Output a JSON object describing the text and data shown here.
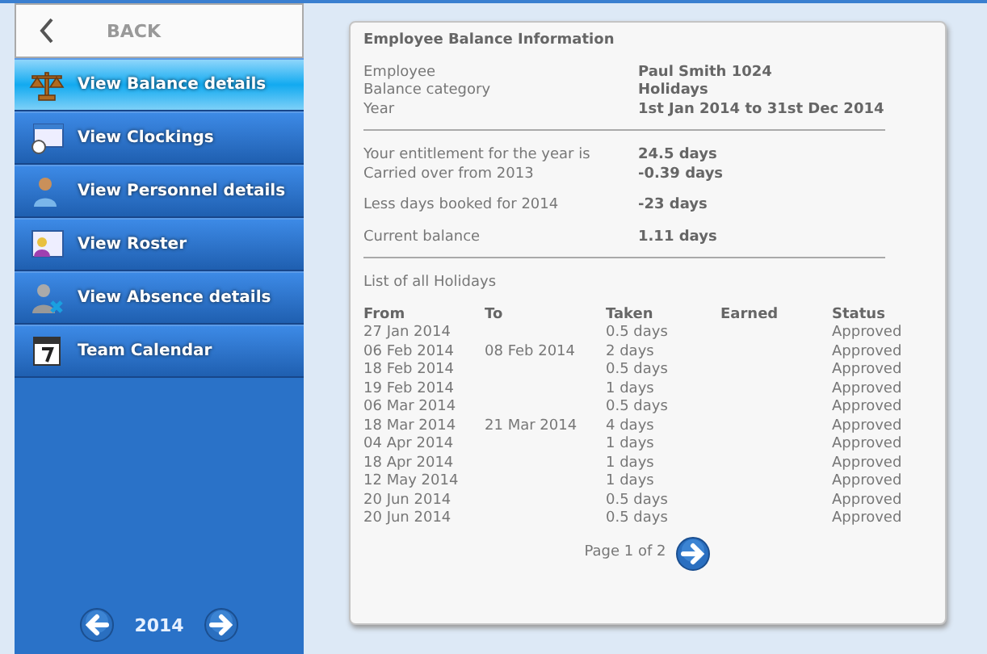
{
  "sidebar": {
    "back": {
      "label": "BACK"
    },
    "items": [
      {
        "label": "View Balance details",
        "selected": true
      },
      {
        "label": "View Clockings",
        "selected": false
      },
      {
        "label": "View Personnel details",
        "selected": false
      },
      {
        "label": "View Roster",
        "selected": false
      },
      {
        "label": "View Absence details",
        "selected": false
      },
      {
        "label": "Team Calendar",
        "selected": false
      }
    ],
    "year": "2014"
  },
  "card": {
    "title": "Employee Balance Information",
    "info": [
      {
        "label": "Employee",
        "value": "Paul Smith 1024"
      },
      {
        "label": "Balance category",
        "value": "Holidays"
      },
      {
        "label": "Year",
        "value": "1st Jan 2014 to 31st Dec 2014"
      }
    ],
    "balance": [
      {
        "label": "Your entitlement for the year is",
        "value": "24.5 days"
      },
      {
        "label": "Carried over from 2013",
        "value": "-0.39 days"
      },
      {
        "label": "Less days booked for 2014",
        "value": "-23 days"
      },
      {
        "label": "Current balance",
        "value": "1.11 days"
      }
    ],
    "list_title": "List of all Holidays",
    "table": {
      "columns": [
        "From",
        "To",
        "Taken",
        "Earned",
        "Status"
      ],
      "rows": [
        {
          "from": "27 Jan 2014",
          "taken": "0.5 days",
          "status": "Approved"
        },
        {
          "from": "06 Feb 2014",
          "to": "08 Feb 2014",
          "taken": "2 days",
          "status": "Approved"
        },
        {
          "from": "18 Feb 2014",
          "taken": "0.5 days",
          "status": "Approved"
        },
        {
          "from": "19 Feb 2014",
          "taken": "1 days",
          "status": "Approved"
        },
        {
          "from": "06 Mar 2014",
          "taken": "0.5 days",
          "status": "Approved"
        },
        {
          "from": "18 Mar 2014",
          "to": "21 Mar 2014",
          "taken": "4 days",
          "status": "Approved"
        },
        {
          "from": "04 Apr 2014",
          "taken": "1 days",
          "status": "Approved"
        },
        {
          "from": "18 Apr 2014",
          "taken": "1 days",
          "status": "Approved"
        },
        {
          "from": "12 May 2014",
          "taken": "1 days",
          "status": "Approved"
        },
        {
          "from": "20 Jun 2014",
          "taken": "0.5 days",
          "status": "Approved"
        },
        {
          "from": "20 Jun 2014",
          "taken": "0.5 days",
          "status": "Approved"
        }
      ]
    },
    "pager": "Page 1 of 2"
  }
}
